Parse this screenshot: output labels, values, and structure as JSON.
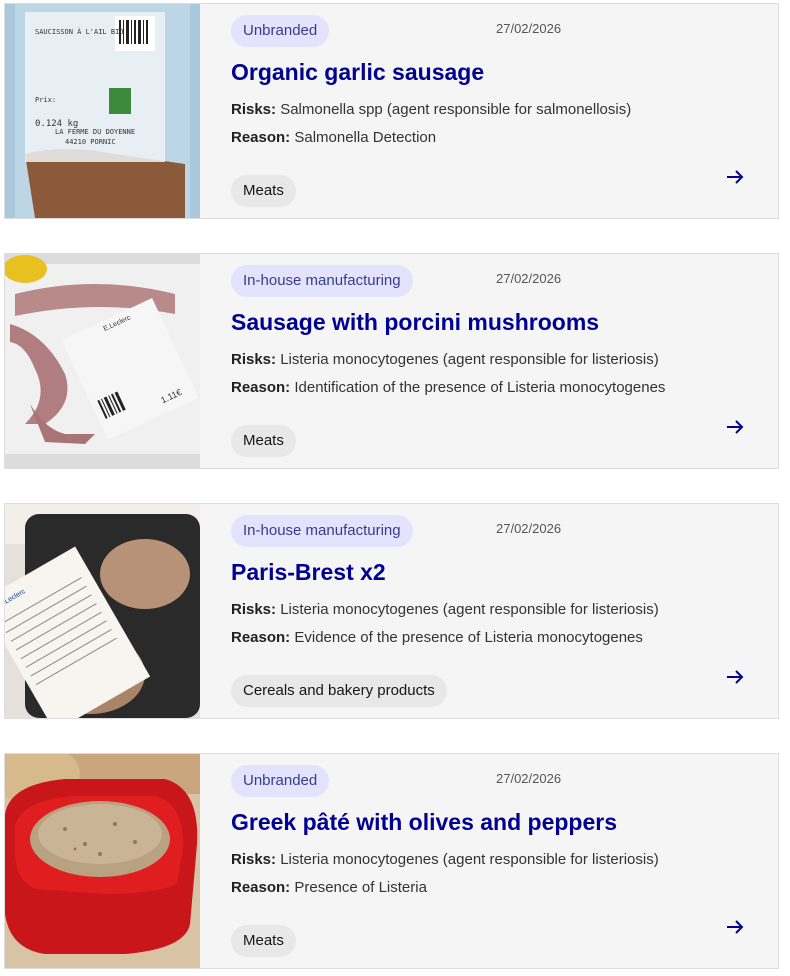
{
  "cards": [
    {
      "badge": "Unbranded",
      "date": "27/02/2026",
      "title": "Organic garlic sausage",
      "risks_label": "Risks:",
      "risks": "Salmonella spp (agent responsible for salmonellosis)",
      "reason_label": "Reason:",
      "reason": "Salmonella Detection",
      "category": "Meats",
      "image": {
        "label_line1": "SAUCISSON À L'AIL BIO",
        "label_line2": "Prix:",
        "label_line3": "LA FERME DU DOYENNE",
        "label_line4": "44210 PORNIC",
        "label_line5": "0.124 kg"
      }
    },
    {
      "badge": "In-house manufacturing",
      "date": "27/02/2026",
      "title": "Sausage with porcini mushrooms",
      "risks_label": "Risks:",
      "risks": "Listeria monocytogenes (agent responsible for listeriosis)",
      "reason_label": "Reason:",
      "reason": "Identification of the presence of Listeria monocytogenes",
      "category": "Meats",
      "image": {
        "label_line1": "E.Leclerc",
        "label_line2": "1.11€"
      }
    },
    {
      "badge": "In-house manufacturing",
      "date": "27/02/2026",
      "title": "Paris-Brest x2",
      "risks_label": "Risks:",
      "risks": "Listeria monocytogenes (agent responsible for listeriosis)",
      "reason_label": "Reason:",
      "reason": "Evidence of the presence of Listeria monocytogenes",
      "category": "Cereals and bakery products",
      "image": {
        "label_line1": "E.Leclerc"
      }
    },
    {
      "badge": "Unbranded",
      "date": "27/02/2026",
      "title": "Greek pâté with olives and peppers",
      "risks_label": "Risks:",
      "risks": "Listeria monocytogenes (agent responsible for listeriosis)",
      "reason_label": "Reason:",
      "reason": "Presence of Listeria",
      "category": "Meats",
      "image": {}
    }
  ],
  "colors": {
    "title": "#000091",
    "badge_bg": "#e3e3fd",
    "card_bg": "#f5f5f5",
    "tag_bg": "#e8e8e8"
  },
  "icons": {
    "arrow": "arrow-right-icon"
  }
}
